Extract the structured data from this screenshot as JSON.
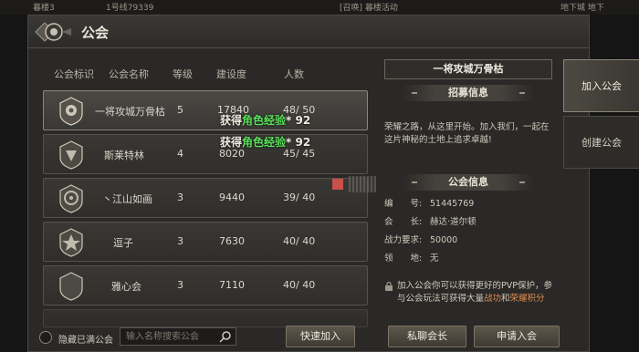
{
  "topbar": {
    "left": "暮楼3",
    "coords": "1号线79339",
    "mid": "[召唤] 暮楼活动",
    "right": "地下城 地下"
  },
  "window": {
    "title": "公会"
  },
  "table": {
    "headers": [
      "公会标识",
      "公会名称",
      "等级",
      "建设度",
      "人数"
    ],
    "rows": [
      {
        "name": "一将攻城万骨枯",
        "level": "5",
        "build": "17840",
        "members": "48/ 50"
      },
      {
        "name": "斯莱特林",
        "level": "4",
        "build": "8020",
        "members": "45/ 45"
      },
      {
        "name": "丶江山如画",
        "level": "3",
        "build": "9440",
        "members": "39/ 40"
      },
      {
        "name": "逗子",
        "level": "3",
        "build": "7630",
        "members": "40/ 40"
      },
      {
        "name": "雅心会",
        "level": "3",
        "build": "7110",
        "members": "40/ 40"
      }
    ]
  },
  "xp_popups": [
    {
      "prefix": "获得",
      "highlight": "角色经验",
      "suffix": "* 92"
    },
    {
      "prefix": "获得",
      "highlight": "角色经验",
      "suffix": "* 92"
    }
  ],
  "filters": {
    "hide_full_label": "隐藏已满公会",
    "search_placeholder": "输入名称搜索公会"
  },
  "buttons": {
    "quick_join": "快速加入",
    "message_leader": "私聊会长",
    "apply": "申请入会"
  },
  "info": {
    "guild_name": "一将攻城万骨枯",
    "recruit_header": "招募信息",
    "recruit_text": "荣耀之路，从这里开始。加入我们，一起在这片神秘的土地上追求卓越!",
    "guild_info_header": "公会信息",
    "fields": [
      {
        "key": "编　　号:",
        "value": "51445769"
      },
      {
        "key": "会　　长:",
        "value": "赫达·道尔顿"
      },
      {
        "key": "战力要求:",
        "value": "50000"
      },
      {
        "key": "领　　地:",
        "value": "无"
      }
    ],
    "notice_a": "加入公会你可以获得更好的PVP保护，参与公会玩法可获得大量",
    "notice_hl1": "战功",
    "notice_b": "和",
    "notice_hl2": "荣耀积分"
  },
  "tabs": {
    "join": "加入公会",
    "create": "创建公会"
  }
}
